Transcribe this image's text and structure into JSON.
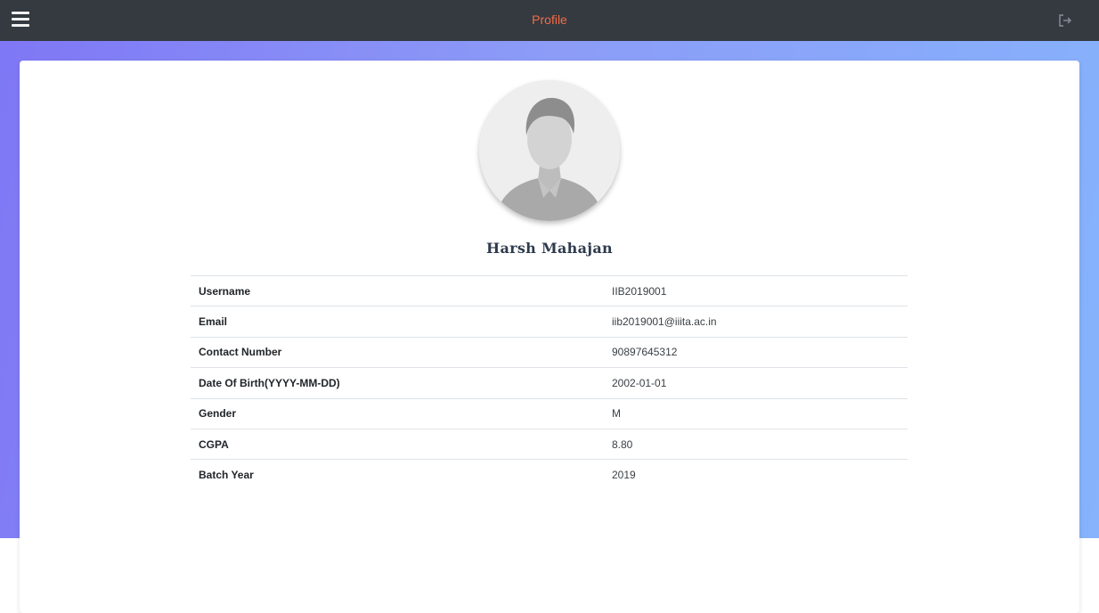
{
  "header": {
    "title": "Profile",
    "menu_icon": "hamburger-menu-icon",
    "logout_icon": "logout-icon",
    "background_color": "#343a40",
    "title_color": "#f46c4a"
  },
  "profile": {
    "avatar_icon": "default-user-avatar",
    "name": "Harsh Mahajan",
    "fields": [
      {
        "label": "Username",
        "value": "IIB2019001"
      },
      {
        "label": "Email",
        "value": "iib2019001@iiita.ac.in"
      },
      {
        "label": "Contact Number",
        "value": "90897645312"
      },
      {
        "label": "Date Of Birth(YYYY-MM-DD)",
        "value": "2002-01-01"
      },
      {
        "label": "Gender",
        "value": "M"
      },
      {
        "label": "CGPA",
        "value": "8.80"
      },
      {
        "label": "Batch Year",
        "value": "2019"
      }
    ]
  },
  "theme": {
    "gradient_start": "#7f77f5",
    "gradient_end": "#86b3fc"
  }
}
